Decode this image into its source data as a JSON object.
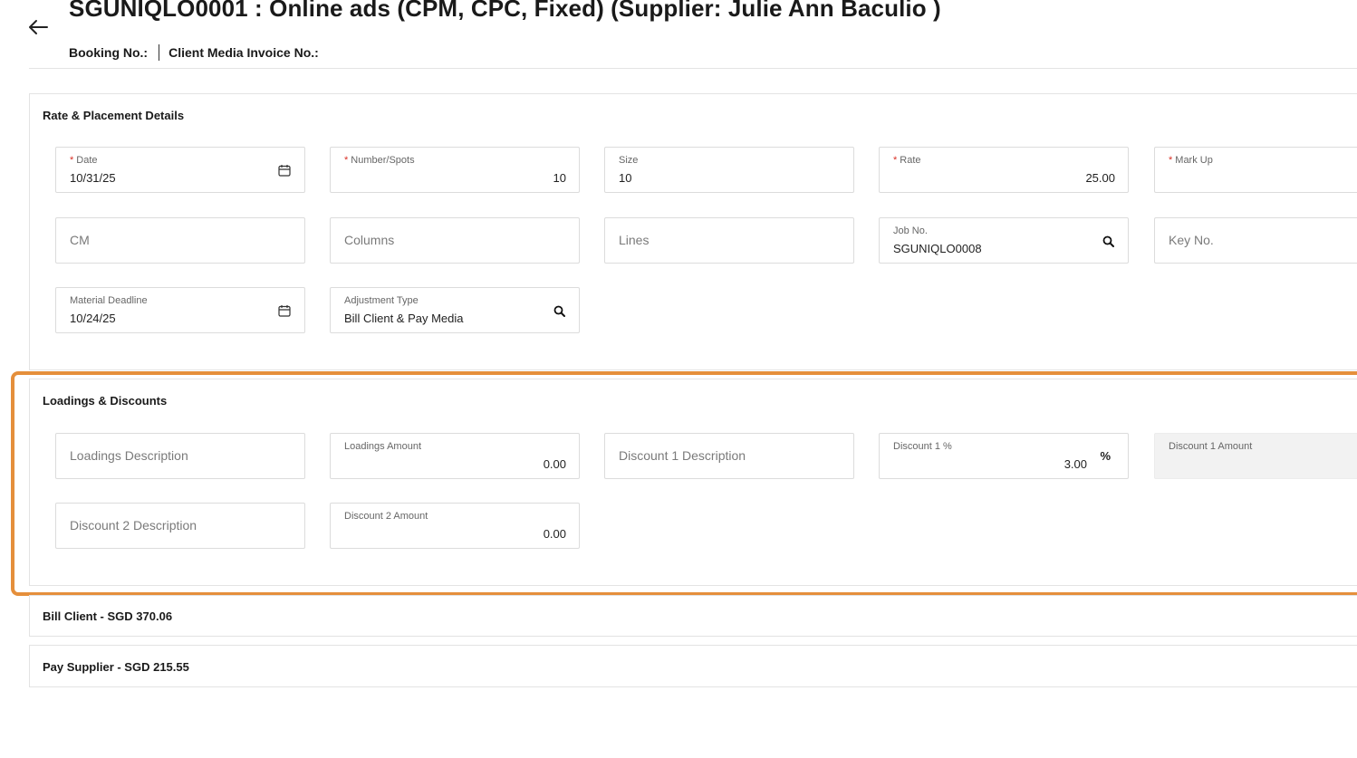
{
  "header": {
    "title": "SGUNIQLO0001 :  Online ads (CPM, CPC, Fixed)  (Supplier:  Julie Ann Baculio )",
    "booking_label": "Booking No.:",
    "invoice_label": "Client Media Invoice No.:"
  },
  "rate_section": {
    "title": "Rate & Placement Details",
    "date": {
      "label": "Date",
      "value": "10/31/25"
    },
    "spots": {
      "label": "Number/Spots",
      "value": "10"
    },
    "size": {
      "label": "Size",
      "value": "10"
    },
    "rate": {
      "label": "Rate",
      "value": "25.00"
    },
    "markup": {
      "label": "Mark Up",
      "value": ""
    },
    "cm": {
      "placeholder": "CM"
    },
    "columns": {
      "placeholder": "Columns"
    },
    "lines": {
      "placeholder": "Lines"
    },
    "job": {
      "label": "Job No.",
      "value": "SGUNIQLO0008"
    },
    "key": {
      "placeholder": "Key No."
    },
    "deadline": {
      "label": "Material Deadline",
      "value": "10/24/25"
    },
    "adjustment": {
      "label": "Adjustment Type",
      "value": "Bill Client & Pay Media"
    }
  },
  "loadings_section": {
    "title": "Loadings & Discounts",
    "loadings_desc": {
      "placeholder": "Loadings Description"
    },
    "loadings_amount": {
      "label": "Loadings Amount",
      "value": "0.00"
    },
    "discount1_desc": {
      "placeholder": "Discount 1 Description"
    },
    "discount1_pct": {
      "label": "Discount 1 %",
      "value": "3.00",
      "suffix": "%"
    },
    "discount1_amount": {
      "label": "Discount 1 Amount",
      "value": ""
    },
    "discount2_desc": {
      "placeholder": "Discount 2 Description"
    },
    "discount2_amount": {
      "label": "Discount 2 Amount",
      "value": "0.00"
    }
  },
  "bill_client": {
    "title": "Bill Client - SGD 370.06"
  },
  "pay_supplier": {
    "title": "Pay Supplier - SGD 215.55"
  },
  "colors": {
    "highlight": "#e58f3b",
    "required": "#d93025",
    "border": "#dcdcdc"
  },
  "icons": {
    "back": "arrow-left-icon",
    "calendar": "calendar-icon",
    "search": "search-icon"
  }
}
